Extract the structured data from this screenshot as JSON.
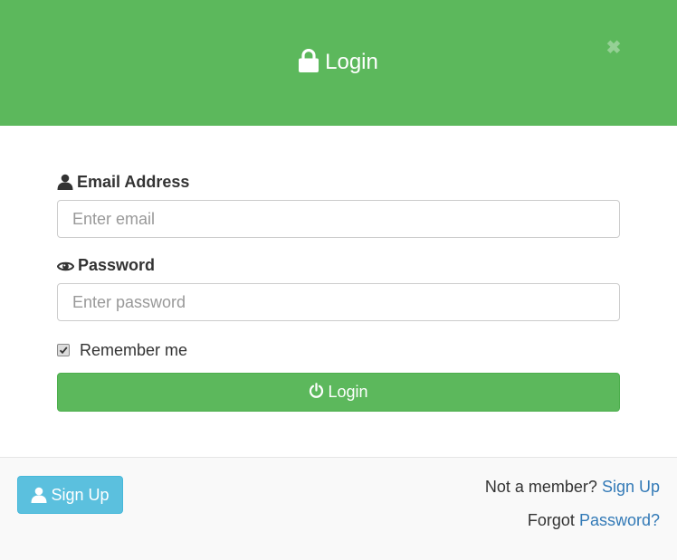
{
  "header": {
    "title": "Login",
    "close_symbol": "✖",
    "icons": {
      "title_icon": "lock-icon",
      "close_icon": "close-icon"
    }
  },
  "form": {
    "email": {
      "label": "Email Address",
      "icon": "user-icon",
      "placeholder": "Enter email",
      "value": ""
    },
    "password": {
      "label": "Password",
      "icon": "eye-icon",
      "placeholder": "Enter password",
      "value": ""
    },
    "remember": {
      "label": "Remember me",
      "checked": true
    },
    "submit": {
      "label": "Login",
      "icon": "power-icon"
    }
  },
  "footer": {
    "signup_button": {
      "label": "Sign Up",
      "icon": "user-icon"
    },
    "not_member_text": "Not a member?",
    "not_member_link": "Sign Up",
    "forgot_text": "Forgot",
    "forgot_link": "Password?"
  },
  "colors": {
    "success": "#5cb85c",
    "info": "#5bc0de",
    "link": "#337ab7",
    "footer_bg": "#f9f9f9"
  }
}
